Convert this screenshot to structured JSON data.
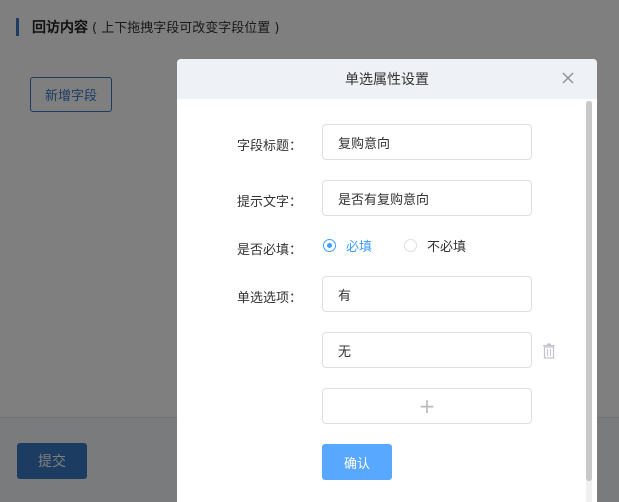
{
  "page": {
    "section_title": "回访内容",
    "section_hint": "( 上下拖拽字段可改变字段位置 )",
    "add_field_label": "新增字段",
    "submit_label": "提交"
  },
  "dialog": {
    "title": "单选属性设置",
    "close_icon": "close-icon",
    "field_title_label": "字段标题：",
    "field_title_value": "复购意向",
    "hint_text_label": "提示文字：",
    "hint_text_value": "是否有复购意向",
    "required_label": "是否必填：",
    "required_options": [
      "必填",
      "不必填"
    ],
    "required_selected": "必填",
    "options_label": "单选选项：",
    "options": [
      "有",
      "无"
    ],
    "add_option_symbol": "+",
    "confirm_label": "确认"
  },
  "colors": {
    "primary": "#3a78c3",
    "accent": "#409eff",
    "confirm": "#58a8ff",
    "overlay": "rgba(0,0,0,0.5)"
  }
}
